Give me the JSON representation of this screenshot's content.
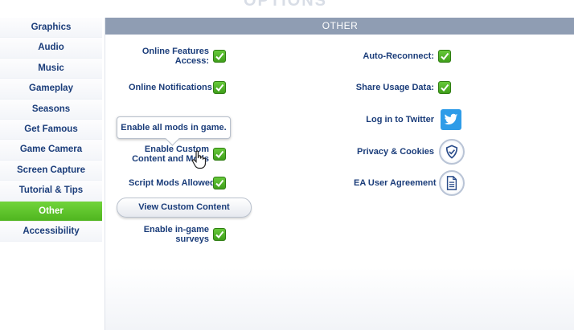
{
  "page": {
    "title_faint": "OPTIONS"
  },
  "sidebar": {
    "items": [
      {
        "label": "Graphics"
      },
      {
        "label": "Audio"
      },
      {
        "label": "Music"
      },
      {
        "label": "Gameplay"
      },
      {
        "label": "Seasons"
      },
      {
        "label": "Get Famous"
      },
      {
        "label": "Game Camera"
      },
      {
        "label": "Screen Capture"
      },
      {
        "label": "Tutorial & Tips"
      },
      {
        "label": "Other"
      },
      {
        "label": "Accessibility"
      }
    ],
    "active": "Other"
  },
  "panel": {
    "header": "OTHER",
    "left": {
      "online_features": "Online Features Access:",
      "online_notifications": "Online Notifications:",
      "tooltip": "Enable all mods in game.",
      "custom_content": "Enable Custom Content and Mods",
      "script_mods": "Script Mods Allowed",
      "view_cc_button": "View Custom Content",
      "surveys": "Enable in-game surveys"
    },
    "right": {
      "auto_reconnect": "Auto-Reconnect:",
      "share_usage": "Share Usage Data:",
      "twitter": "Log in to Twitter",
      "privacy": "Privacy & Cookies",
      "user_agreement": "EA User Agreement"
    }
  },
  "colors": {
    "accent_green": "#5cc22c",
    "header_gray": "#8f9db3",
    "text_blue": "#1b3d7a",
    "twitter_blue": "#2f9ce8"
  },
  "icons": [
    "checkmark-icon",
    "twitter-bird-icon",
    "shield-check-icon",
    "document-icon",
    "hand-cursor-icon"
  ]
}
